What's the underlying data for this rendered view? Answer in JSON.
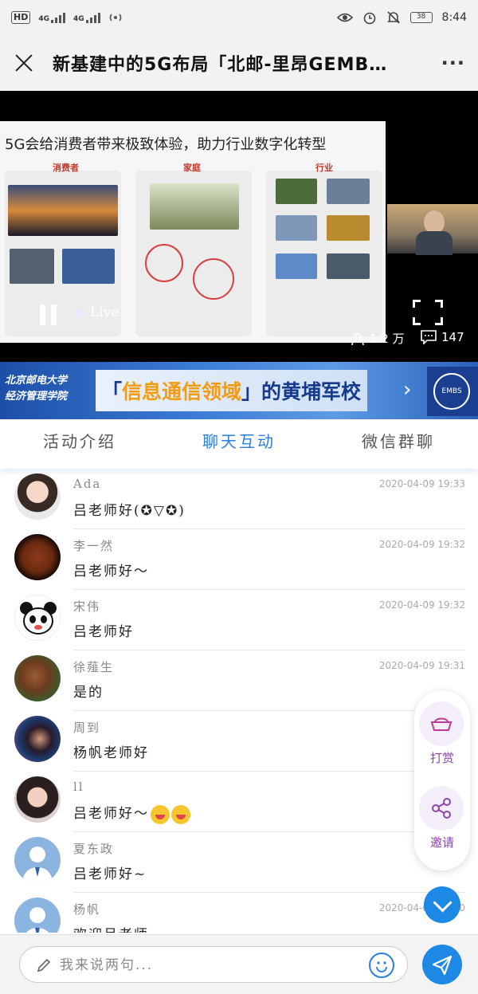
{
  "status_bar": {
    "net_tag": "HD",
    "sig1": "4G",
    "sig2": "4G",
    "battery": "38",
    "time": "8:44"
  },
  "header": {
    "title": "新基建中的5G布局「北邮-里昂GEMB…",
    "more_label": "···"
  },
  "video": {
    "slide_title": "5G会给消费者带来极致体验，助力行业数字化转型",
    "panels": [
      {
        "heading": "消费者"
      },
      {
        "heading": "家庭"
      },
      {
        "heading": "行业"
      }
    ],
    "live_label": "Live",
    "views": "1.2 万",
    "comments": "147"
  },
  "banner": {
    "school_line1": "北京邮电大学",
    "school_line2": "经济管理学院",
    "slogan_prefix": "「",
    "slogan_highlight": "信息通信领域",
    "slogan_suffix": "」的黄埔军校",
    "logo_text": "EMBS"
  },
  "tabs": [
    {
      "label": "活动介绍",
      "active": false
    },
    {
      "label": "聊天互动",
      "active": true
    },
    {
      "label": "微信群聊",
      "active": false
    }
  ],
  "messages": [
    {
      "name": "Ada",
      "text": "吕老师好(✪▽✪)",
      "time": "2020-04-09 19:33"
    },
    {
      "name": "李一然",
      "text": "吕老师好～",
      "time": "2020-04-09 19:32"
    },
    {
      "name": "宋伟",
      "text": "吕老师好",
      "time": "2020-04-09 19:32"
    },
    {
      "name": "徐薤生",
      "text": "是的",
      "time": "2020-04-09 19:31"
    },
    {
      "name": "周到",
      "text": "杨帆老师好",
      "time": "2020-0"
    },
    {
      "name": "ll",
      "text": "吕老师好～",
      "time": "2020-0"
    },
    {
      "name": "夏东政",
      "text": "吕老师好~",
      "time": "2020-0"
    },
    {
      "name": "杨帆",
      "text": "欢迎吕老师",
      "time": "2020-04-09 19:30"
    }
  ],
  "floating": {
    "tip_label": "打赏",
    "invite_label": "邀请"
  },
  "composer": {
    "placeholder": "我来说两句..."
  },
  "colors": {
    "accent": "#2a7de1",
    "send": "#1e88e5",
    "float_text": "#8e44ad"
  }
}
